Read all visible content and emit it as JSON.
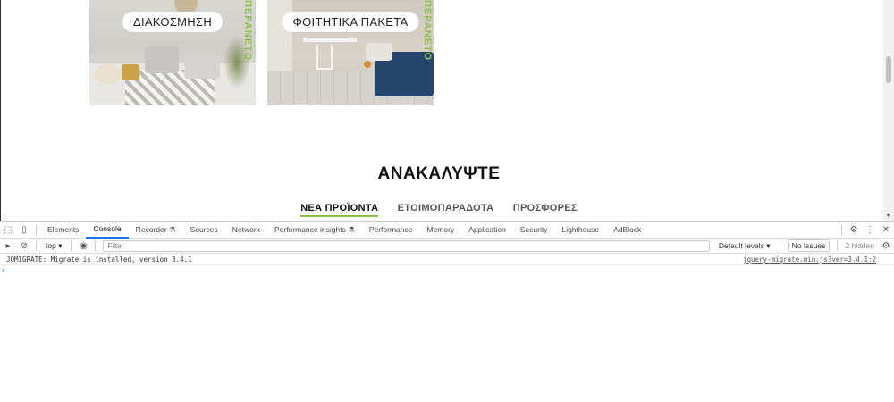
{
  "page": {
    "cards": [
      {
        "label": "ΔΙΑΚΟΣΜΗΣΗ",
        "vertical_text": "ΠΕΡΑΝΕΤΟ"
      },
      {
        "label": "ΦΟΙΤΗΤΙΚΑ ΠΑΚΕΤΑ",
        "vertical_text": "ΠΕΡΑΝΕΤΟ"
      }
    ],
    "section_title": "ΑΝΑΚΑΛΥΨΤΕ",
    "tabs": [
      "ΝΕΑ ΠΡΟΪΟΝΤΑ",
      "ΕΤΟΙΜΟΠΑΡΑΔΟΤΑ",
      "ΠΡΟΣΦΟΡΕΣ"
    ],
    "accent_color": "#8bc34a"
  },
  "devtools": {
    "tabs": [
      "Elements",
      "Console",
      "Recorder",
      "Sources",
      "Network",
      "Performance insights",
      "Performance",
      "Memory",
      "Application",
      "Security",
      "Lighthouse",
      "AdBlock"
    ],
    "active_tab": "Console",
    "context": "top",
    "filter_placeholder": "Filter",
    "levels": "Default levels",
    "issues": "No Issues",
    "hidden": "2 hidden",
    "messages": [
      {
        "text": "JQMIGRATE: Migrate is installed, version 3.4.1",
        "source": "jquery-migrate.min.js?ver=3.4.1:2"
      }
    ]
  }
}
